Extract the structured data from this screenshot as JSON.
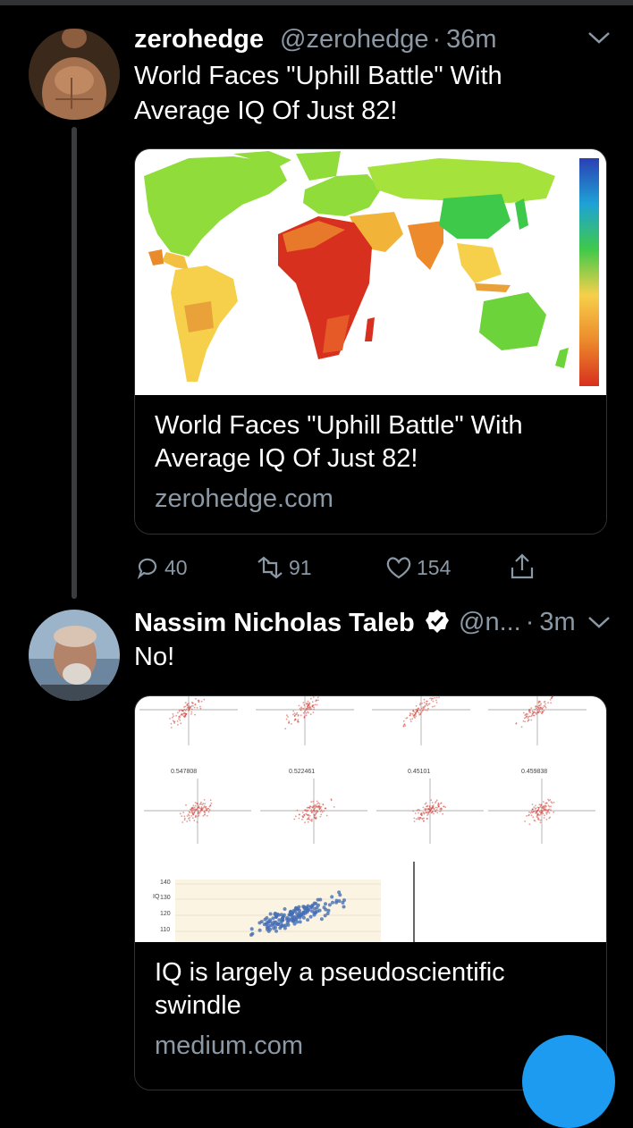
{
  "tweet1": {
    "name": "zerohedge",
    "handle": "@zerohedge",
    "sep": "·",
    "time": "36m",
    "text_line1": "World Faces \"Uphill Battle\" With",
    "text_line2": "Average IQ Of Just 82!",
    "card": {
      "title_line1": "World Faces \"Uphill Battle\" With",
      "title_line2": "Average IQ Of Just 82!",
      "domain": "zerohedge.com"
    },
    "actions": {
      "replies": "40",
      "retweets": "91",
      "likes": "154"
    }
  },
  "tweet2": {
    "name": "Nassim Nicholas Taleb",
    "handle": "@n...",
    "sep": "·",
    "time": "3m",
    "text": "No!",
    "card": {
      "title_line1": "IQ is largely a pseudoscientific",
      "title_line2": "swindle",
      "domain": "medium.com",
      "figure": {
        "corr_labels": [
          "0.547808",
          "0.522461",
          "0.45101",
          "0.459838"
        ],
        "y_ticks": [
          "140",
          "130",
          "120",
          "110"
        ],
        "y_label": "IQ"
      }
    }
  },
  "colors": {
    "background": "#000000",
    "secondary_text": "#8b98a5",
    "accent": "#1d9bf0",
    "border": "#2f3336"
  }
}
